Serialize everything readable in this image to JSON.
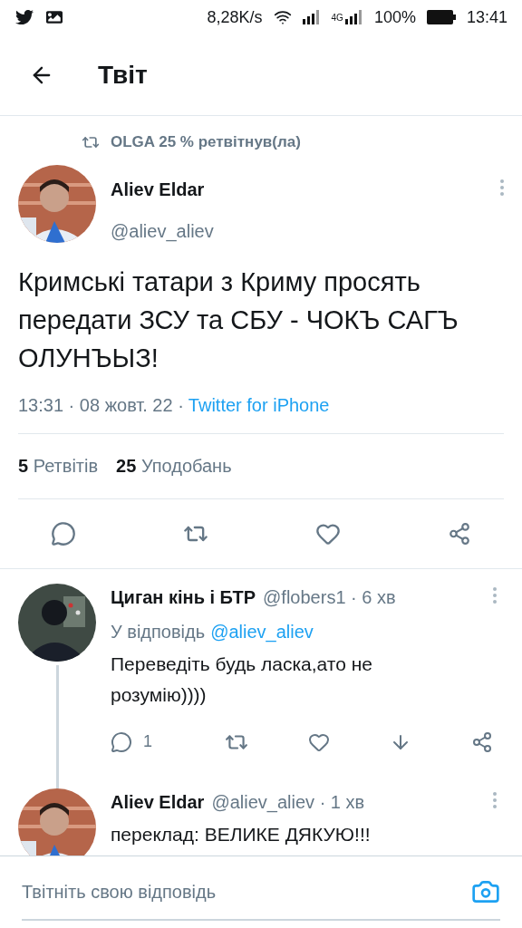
{
  "status_bar": {
    "network_speed": "8,28K/s",
    "network_type": "4G",
    "battery": "100%",
    "time": "13:41"
  },
  "header": {
    "title": "Твіт"
  },
  "tweet": {
    "retweeted_by": "OLGA 25 % ретвітнув(ла)",
    "author": {
      "name": "Aliev Eldar",
      "handle": "@aliev_aliev"
    },
    "text": "Кримські татари з Криму просять передати ЗСУ та СБУ - ЧОКЪ САГЪ ОЛУНЪЫЗ!",
    "meta": "13:31 · 08 жовт. 22 ·",
    "source": "Twitter for iPhone",
    "stats": [
      {
        "count": "5",
        "label": "Ретвітів"
      },
      {
        "count": "25",
        "label": "Уподобань"
      }
    ]
  },
  "replies": [
    {
      "name": "Циган кінь і БТР",
      "handle_time": "@flobers1 · 6 хв",
      "reply_prefix": "У відповідь",
      "reply_to": "@aliev_aliev",
      "text": "Переведіть будь ласка,ато не розумію))))",
      "reply_count": "1",
      "thread_continues": true
    },
    {
      "name": "Aliev Eldar",
      "handle_time": "@aliev_aliev · 1 хв",
      "text": "переклад: ВЕЛИКЕ ДЯКУЮ!!!",
      "thread_continues": false
    }
  ],
  "compose": {
    "placeholder": "Твітніть свою відповідь"
  }
}
